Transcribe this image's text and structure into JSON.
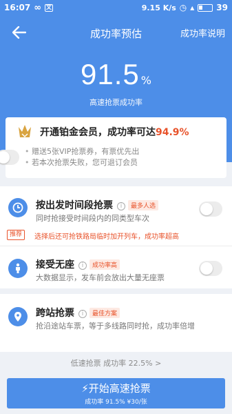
{
  "status_bar": {
    "time": "16:07",
    "left_icons": [
      "infinity-icon",
      "translate-icon"
    ],
    "speed": "9.15 K/s",
    "battery": "39"
  },
  "header": {
    "title": "成功率预估",
    "right_link": "成功率说明"
  },
  "rate": {
    "value": "91.5",
    "unit": "%",
    "caption": "高速抢票成功率"
  },
  "vip": {
    "title_prefix": "开通铂金会员，成功率可达",
    "title_highlight": "94.9%",
    "bullets": [
      "赠送5张VIP抢票券，有票优先出",
      "若本次抢票失败，您可退订会员"
    ],
    "enabled": false
  },
  "options": [
    {
      "title": "按出发时间段抢票",
      "tag": "最多人选",
      "desc": "同时抢接受时间段内的同类型车次",
      "icon": "clock-icon",
      "enabled": false
    },
    {
      "title": "接受无座",
      "tag": "成功率高",
      "desc": "大数据显示，发车前会放出大量无座票",
      "icon": "standing-person-icon",
      "enabled": false
    },
    {
      "title": "跨站抢票",
      "tag": "最佳方案",
      "desc": "抢沿途站车票，等于多线路同时抢，成功率倍增",
      "icon": "location-pin-icon"
    }
  ],
  "recommend": {
    "badge": "推荐",
    "text": "选择后还可抢铁路局临时加开列车，成功率超高"
  },
  "footer": {
    "low_speed": "低速抢票 成功率 22.5% >",
    "start_label": "开始高速抢票",
    "start_sub": "成功率 91.5% ¥30/张"
  },
  "colors": {
    "primary": "#4d8ee8",
    "accent": "#e8532b"
  }
}
